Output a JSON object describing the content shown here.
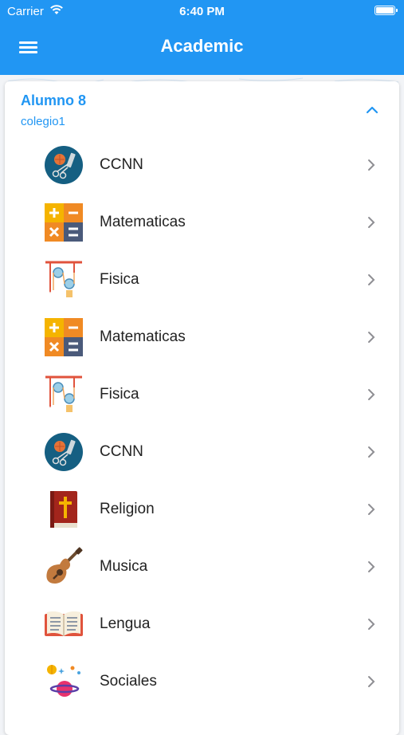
{
  "status_bar": {
    "carrier": "Carrier",
    "time": "6:40 PM"
  },
  "header": {
    "title": "Academic"
  },
  "student": {
    "name": "Alumno 8",
    "school": "colegio1"
  },
  "subjects": [
    {
      "label": "CCNN",
      "icon": "science-icon"
    },
    {
      "label": "Matematicas",
      "icon": "calculator-icon"
    },
    {
      "label": "Fisica",
      "icon": "pulley-icon"
    },
    {
      "label": "Matematicas",
      "icon": "calculator-icon"
    },
    {
      "label": "Fisica",
      "icon": "pulley-icon"
    },
    {
      "label": "CCNN",
      "icon": "science-icon"
    },
    {
      "label": "Religion",
      "icon": "bible-icon"
    },
    {
      "label": "Musica",
      "icon": "guitar-icon"
    },
    {
      "label": "Lengua",
      "icon": "open-book-icon"
    },
    {
      "label": "Sociales",
      "icon": "planets-icon"
    }
  ],
  "colors": {
    "primary": "#2196f3",
    "text": "#222222",
    "chevron": "#8e8e93"
  }
}
